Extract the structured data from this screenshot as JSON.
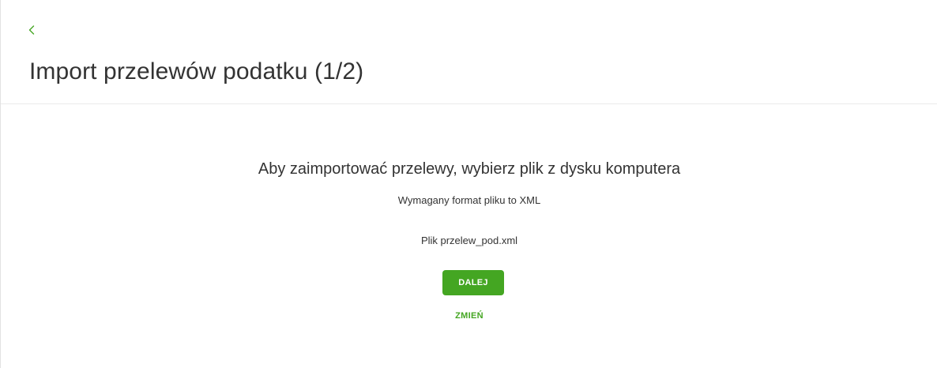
{
  "header": {
    "back_icon": "chevron-left-icon",
    "title": "Import przelewów podatku (1/2)"
  },
  "main": {
    "heading": "Aby zaimportować przelewy, wybierz plik z dysku komputera",
    "format_info": "Wymagany format pliku to XML",
    "file_label": "Plik przelew_pod.xml",
    "next_label": "DALEJ",
    "change_label": "ZMIEŃ"
  },
  "colors": {
    "accent": "#44a622",
    "text": "#333333",
    "divider": "#ebebeb"
  }
}
